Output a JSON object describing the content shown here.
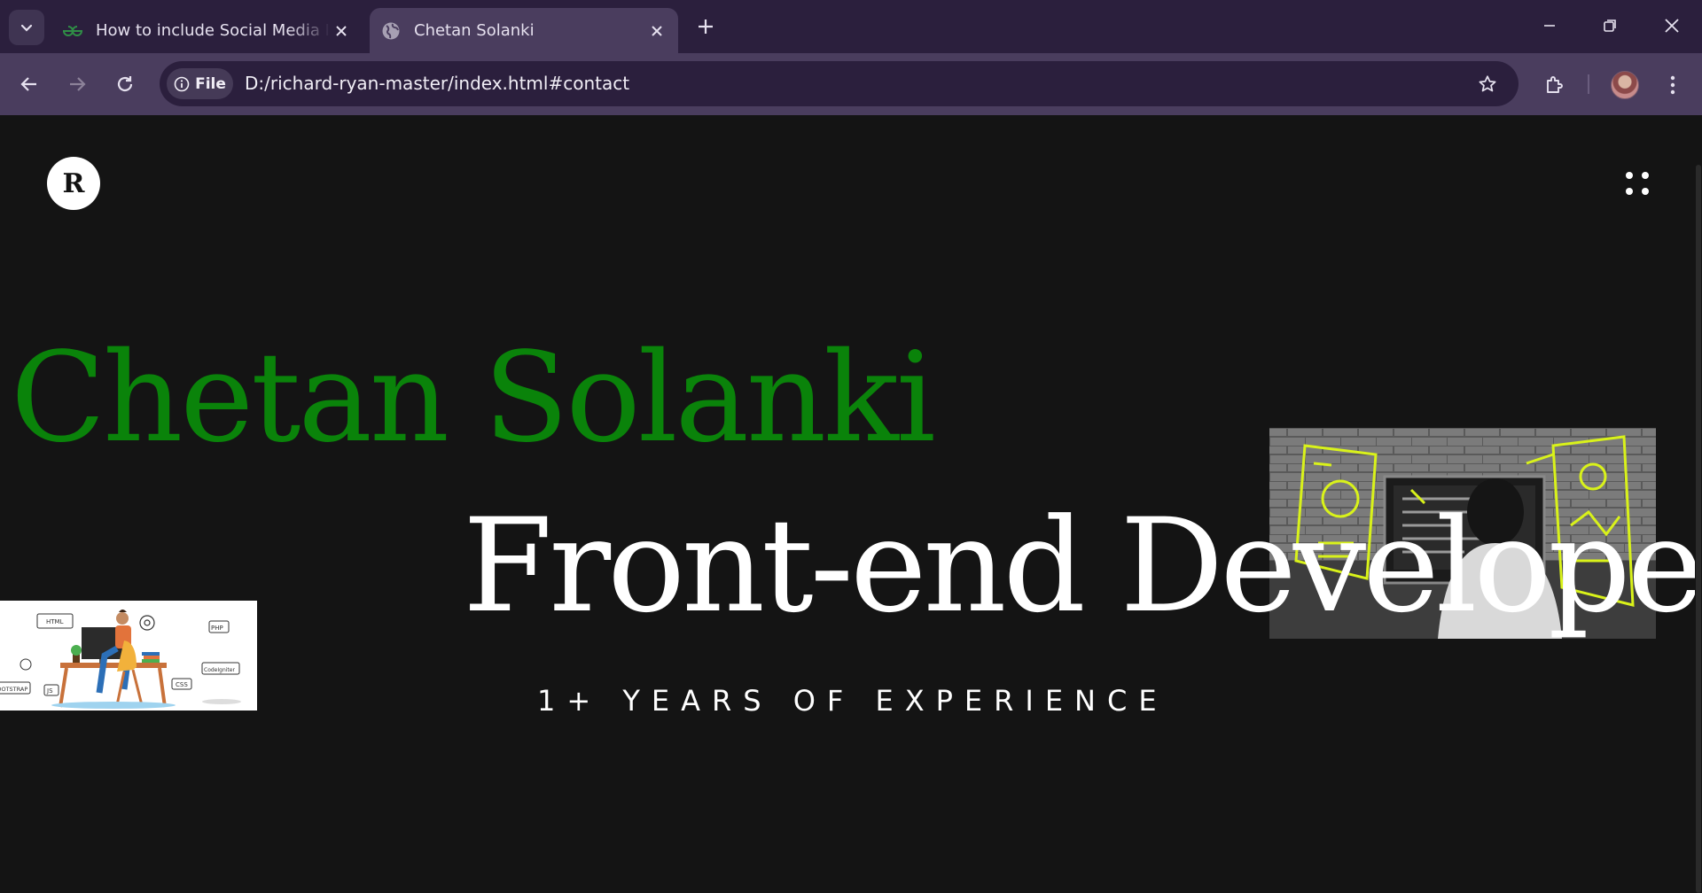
{
  "browser": {
    "tabs": [
      {
        "title": "How to include Social Media Icons in HTML ?",
        "active": false,
        "favicon": "geeksforgeeks-icon"
      },
      {
        "title": "Chetan Solanki",
        "active": true,
        "favicon": "globe-icon"
      }
    ],
    "address": {
      "chip_label": "File",
      "url": "D:/richard-ryan-master/index.html#contact"
    }
  },
  "page": {
    "logo_letter": "R",
    "name": "Chetan Solanki",
    "role": "Front-end Developer",
    "experience": "1+ YEARS OF EXPERIENCE",
    "colors": {
      "background": "#141414",
      "name": "#0a830a",
      "text": "#ffffff"
    },
    "left_image": {
      "labels": [
        "HTML",
        "PHP",
        "CodeIgniter",
        "CSS",
        "JS",
        "BOOTSTRAP"
      ]
    }
  }
}
